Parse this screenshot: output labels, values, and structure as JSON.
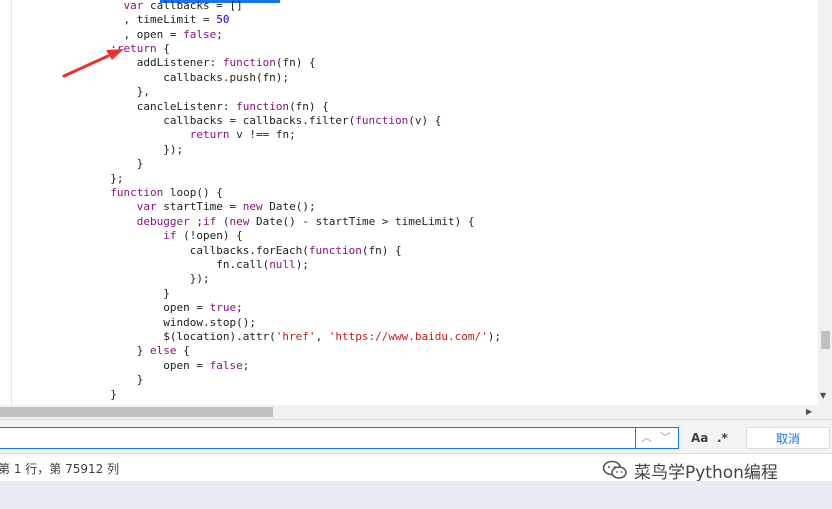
{
  "editor": {
    "lines": [
      [
        {
          "t": "    "
        },
        {
          "t": "var",
          "c": "kw"
        },
        {
          "t": " callbacks = []"
        }
      ],
      [
        {
          "t": "    , timeLimit = "
        },
        {
          "t": "50",
          "c": "num"
        }
      ],
      [
        {
          "t": "    , open = "
        },
        {
          "t": "false",
          "c": "kw"
        },
        {
          "t": ";"
        }
      ],
      [
        {
          "t": "  ;"
        },
        {
          "t": "return",
          "c": "kw"
        },
        {
          "t": " {"
        }
      ],
      [
        {
          "t": "      addListener: "
        },
        {
          "t": "function",
          "c": "kw"
        },
        {
          "t": "(fn) {"
        }
      ],
      [
        {
          "t": "          callbacks.push(fn);"
        }
      ],
      [
        {
          "t": "      },"
        }
      ],
      [
        {
          "t": "      cancleListenr: "
        },
        {
          "t": "function",
          "c": "kw"
        },
        {
          "t": "(fn) {"
        }
      ],
      [
        {
          "t": "          callbacks = callbacks.filter("
        },
        {
          "t": "function",
          "c": "kw"
        },
        {
          "t": "(v) {"
        }
      ],
      [
        {
          "t": "              "
        },
        {
          "t": "return",
          "c": "kw"
        },
        {
          "t": " v !== fn;"
        }
      ],
      [
        {
          "t": "          });"
        }
      ],
      [
        {
          "t": "      }"
        }
      ],
      [
        {
          "t": "  };"
        }
      ],
      [
        {
          "t": "  "
        },
        {
          "t": "function",
          "c": "kw"
        },
        {
          "t": " loop() {"
        }
      ],
      [
        {
          "t": "      "
        },
        {
          "t": "var",
          "c": "kw"
        },
        {
          "t": " startTime = "
        },
        {
          "t": "new",
          "c": "kw"
        },
        {
          "t": " Date();"
        }
      ],
      [
        {
          "t": "      "
        },
        {
          "t": "debugger",
          "c": "kw"
        },
        {
          "t": " ;"
        },
        {
          "t": "if",
          "c": "kw"
        },
        {
          "t": " ("
        },
        {
          "t": "new",
          "c": "kw"
        },
        {
          "t": " Date() - startTime > timeLimit) {"
        }
      ],
      [
        {
          "t": "          "
        },
        {
          "t": "if",
          "c": "kw"
        },
        {
          "t": " (!open) {"
        }
      ],
      [
        {
          "t": "              callbacks.forEach("
        },
        {
          "t": "function",
          "c": "kw"
        },
        {
          "t": "(fn) {"
        }
      ],
      [
        {
          "t": "                  fn.call("
        },
        {
          "t": "null",
          "c": "kw"
        },
        {
          "t": ");"
        }
      ],
      [
        {
          "t": "              });"
        }
      ],
      [
        {
          "t": "          }"
        }
      ],
      [
        {
          "t": "          open = "
        },
        {
          "t": "true",
          "c": "kw"
        },
        {
          "t": ";"
        }
      ],
      [
        {
          "t": "          window.stop();"
        }
      ],
      [
        {
          "t": "          $(location).attr("
        },
        {
          "t": "'href'",
          "c": "str"
        },
        {
          "t": ", "
        },
        {
          "t": "'https://www.baidu.com/'",
          "c": "str"
        },
        {
          "t": ");"
        }
      ],
      [
        {
          "t": "      } "
        },
        {
          "t": "else",
          "c": "kw"
        },
        {
          "t": " {"
        }
      ],
      [
        {
          "t": "          open = "
        },
        {
          "t": "false",
          "c": "kw"
        },
        {
          "t": ";"
        }
      ],
      [
        {
          "t": "      }"
        }
      ],
      [
        {
          "t": "  }"
        }
      ]
    ]
  },
  "search": {
    "value": "",
    "prev_icon": "chevron-up-icon",
    "next_icon": "chevron-down-icon",
    "match_case_label": "Aa",
    "regex_label": ".*",
    "cancel_label": "取消"
  },
  "status": {
    "position_text": "第 1 行，第 75912 列"
  },
  "watermark": {
    "text": "菜鸟学Python编程"
  },
  "colors": {
    "keyword": "#881280",
    "string": "#c41a16",
    "number": "#1c00cf",
    "accent": "#1a73e8",
    "arrow": "#e8322b"
  }
}
